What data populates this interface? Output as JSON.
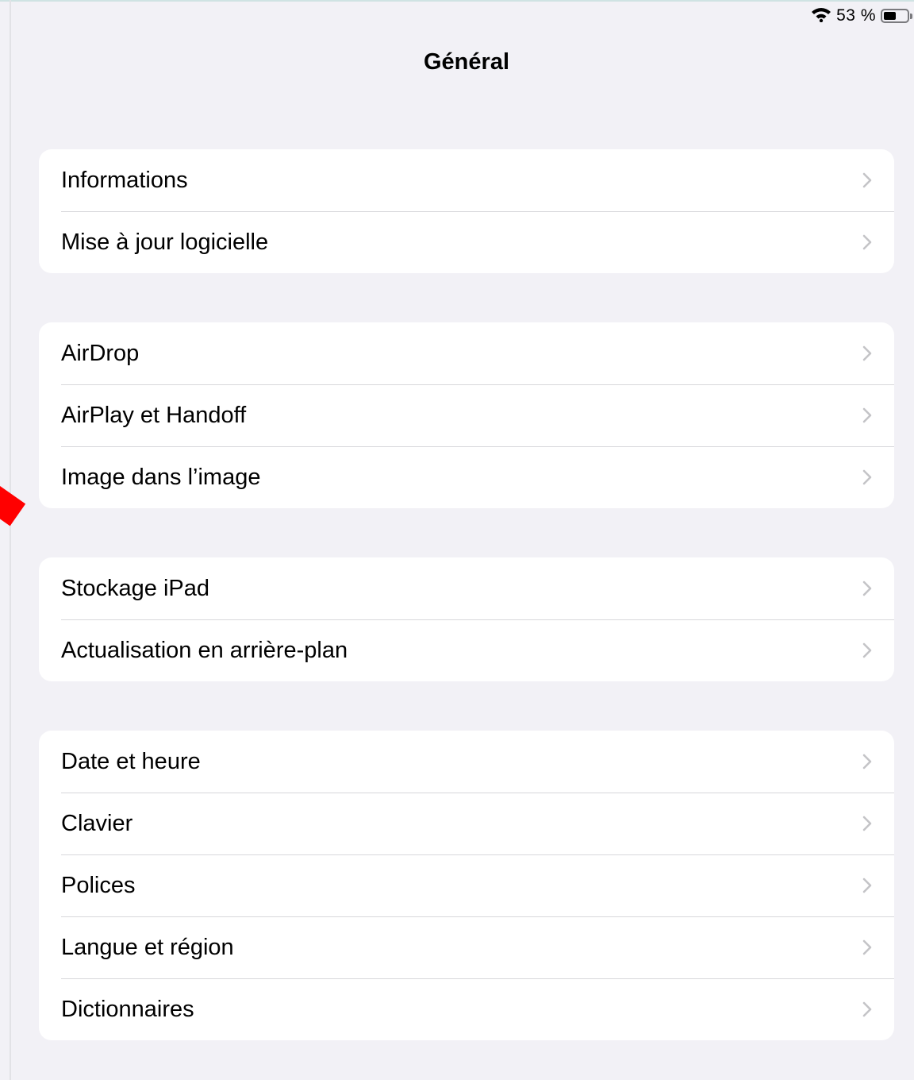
{
  "status_bar": {
    "wifi_icon": "wifi-icon",
    "battery_label": "53 %",
    "battery_level": 0.53
  },
  "header": {
    "title": "Général"
  },
  "groups": [
    {
      "items": [
        {
          "label": "Informations"
        },
        {
          "label": "Mise à jour logicielle"
        }
      ]
    },
    {
      "items": [
        {
          "label": "AirDrop"
        },
        {
          "label": "AirPlay et Handoff"
        },
        {
          "label": "Image dans l’image"
        }
      ]
    },
    {
      "items": [
        {
          "label": "Stockage iPad"
        },
        {
          "label": "Actualisation en arrière-plan"
        }
      ]
    },
    {
      "items": [
        {
          "label": "Date et heure"
        },
        {
          "label": "Clavier"
        },
        {
          "label": "Polices"
        },
        {
          "label": "Langue et région"
        },
        {
          "label": "Dictionnaires"
        }
      ]
    }
  ],
  "colors": {
    "background": "#f2f1f6",
    "cell": "#ffffff",
    "separator": "#d7d7db",
    "chevron": "#c4c4c7",
    "marker": "#ff0000"
  }
}
